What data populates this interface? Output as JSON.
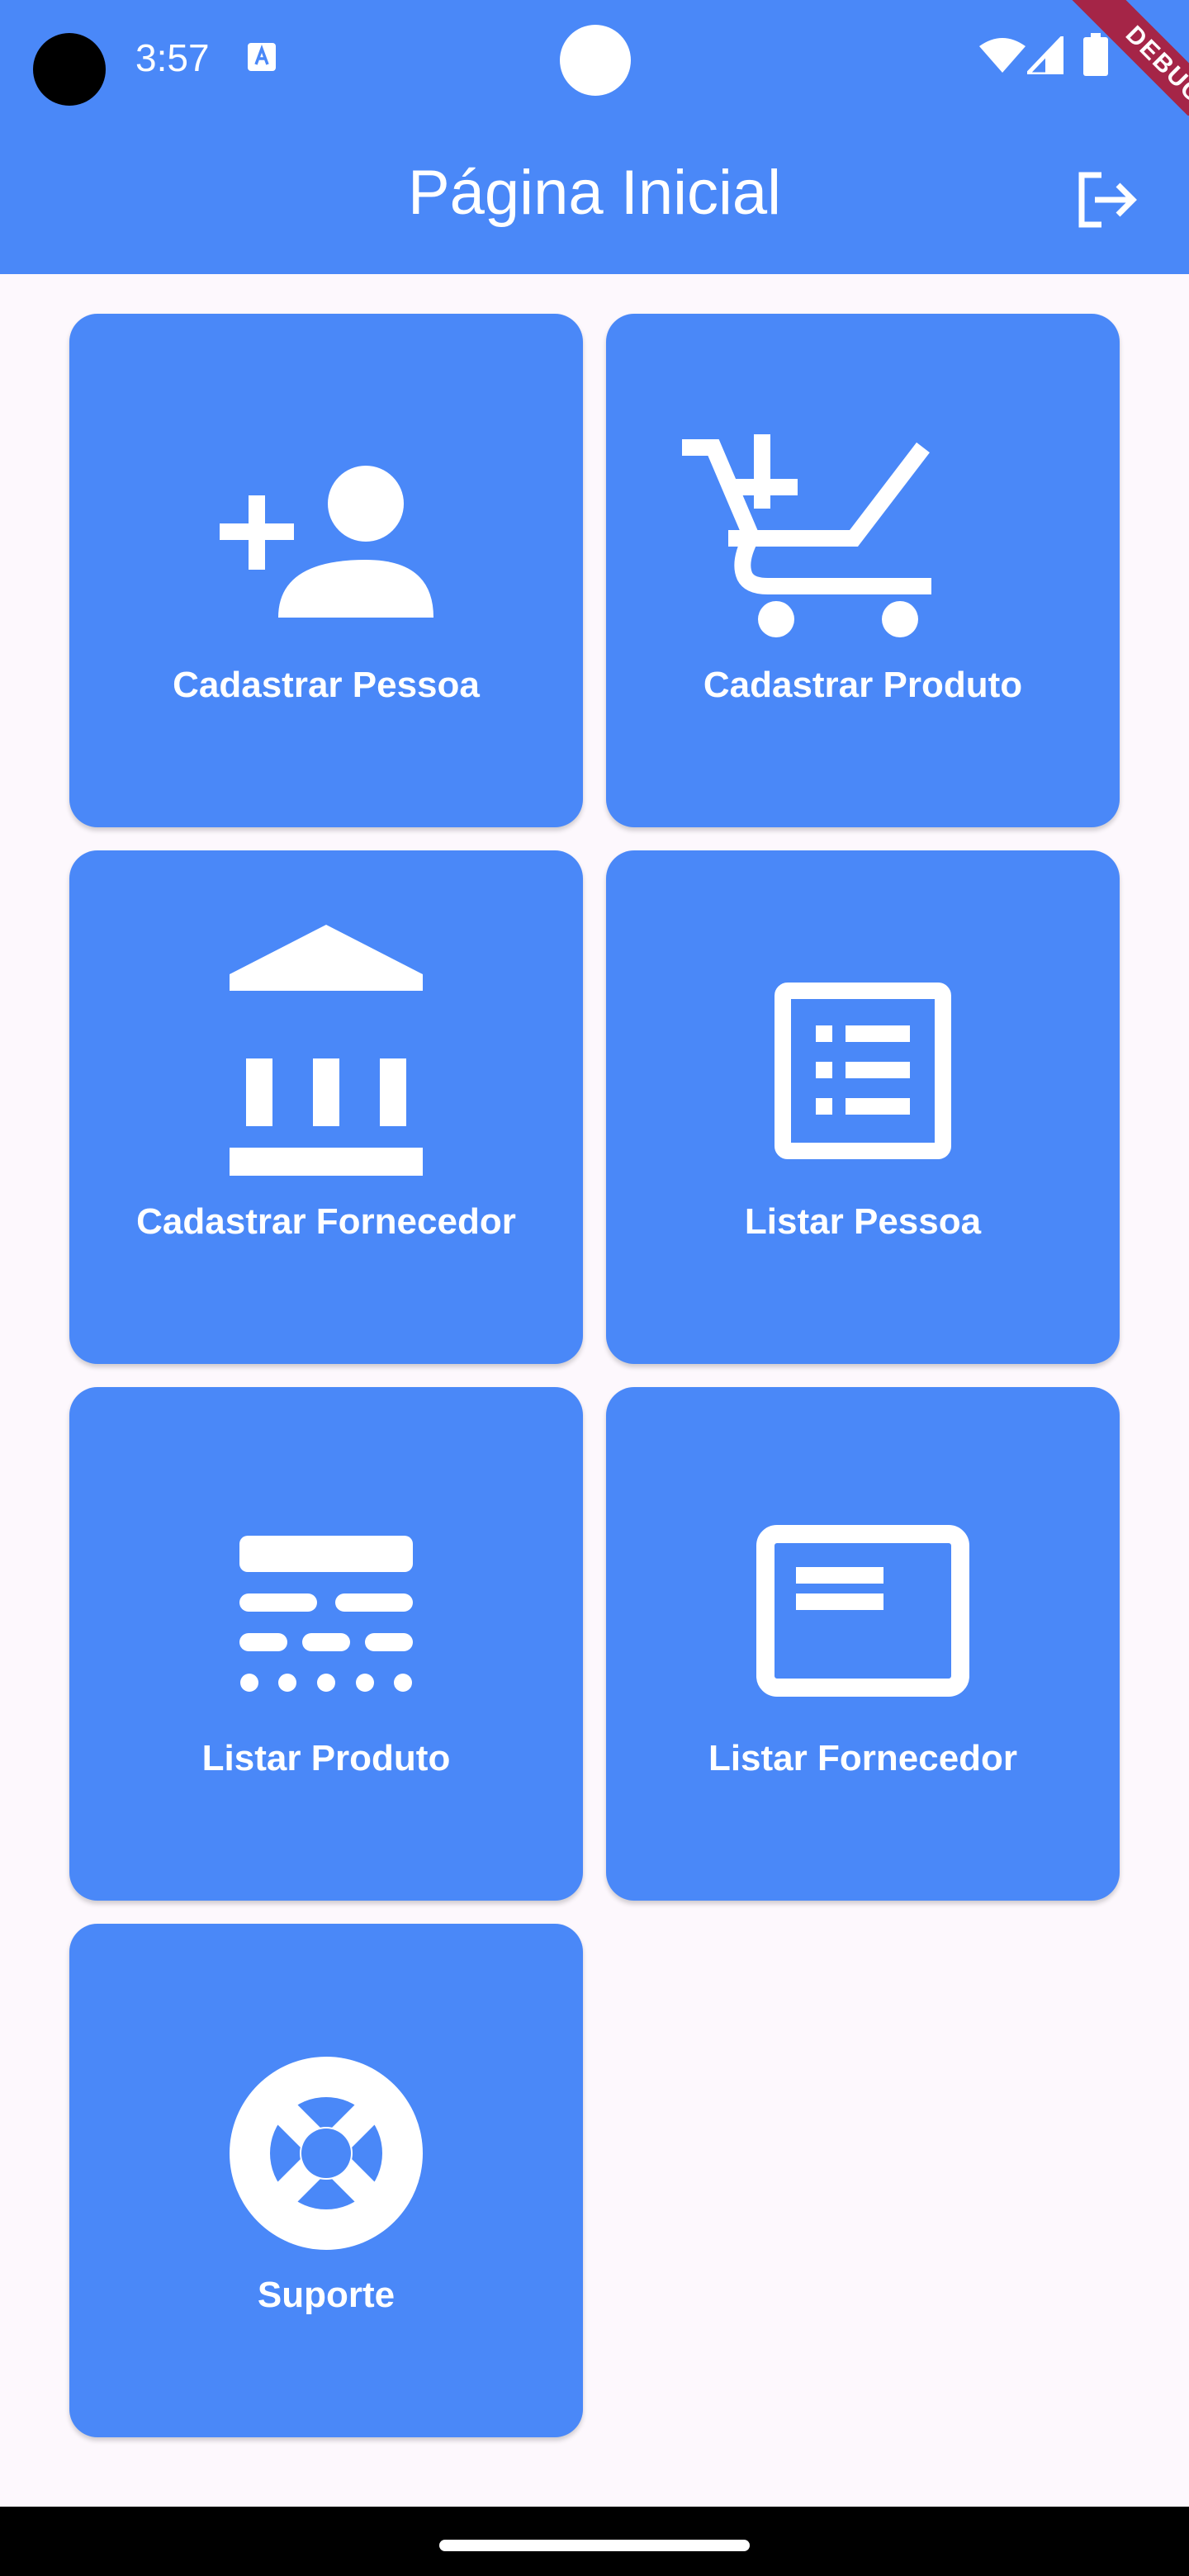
{
  "status_bar": {
    "time": "3:57",
    "icons": [
      "camera-dot",
      "keyboard-a-icon",
      "front-camera",
      "wifi-icon",
      "cell-signal-icon",
      "battery-icon"
    ]
  },
  "debug_banner": {
    "label": "DEBUG"
  },
  "app_bar": {
    "title": "Página Inicial",
    "action_icon": "logout-icon"
  },
  "tiles": [
    {
      "label": "Cadastrar Pessoa",
      "icon": "person-add-icon"
    },
    {
      "label": "Cadastrar Produto",
      "icon": "add-shopping-cart-icon"
    },
    {
      "label": "Cadastrar Fornecedor",
      "icon": "bank-icon"
    },
    {
      "label": "Listar Pessoa",
      "icon": "list-alt-icon"
    },
    {
      "label": "Listar Produto",
      "icon": "dataset-list-icon"
    },
    {
      "label": "Listar Fornecedor",
      "icon": "web-card-icon"
    },
    {
      "label": "Suporte",
      "icon": "life-buoy-icon"
    }
  ],
  "colors": {
    "primary": "#4a88f8",
    "background": "#fdf8fd",
    "debug": "#a52547"
  }
}
